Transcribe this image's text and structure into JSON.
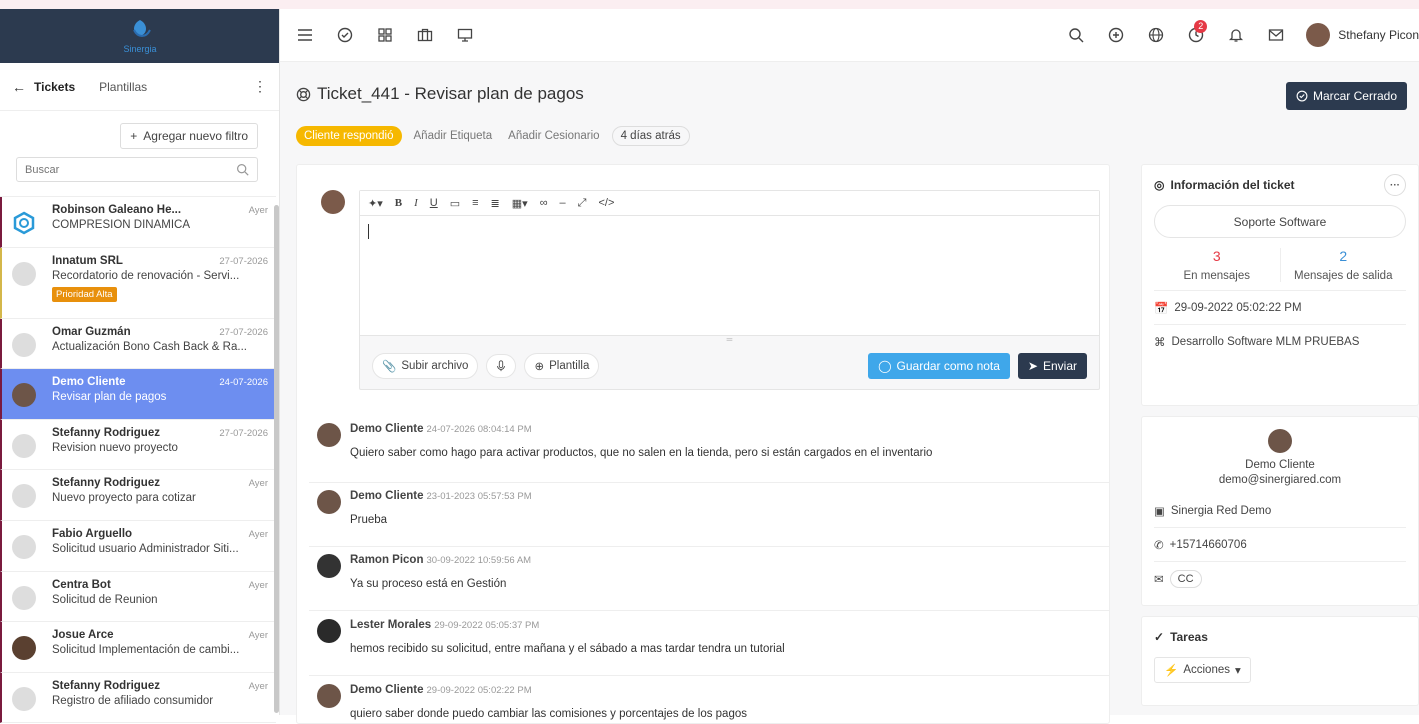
{
  "topbar": {
    "user_name": "Sthefany Picon",
    "timer_badge": "2"
  },
  "sidebar": {
    "tab_tickets": "Tickets",
    "tab_templates": "Plantillas",
    "add_filter": "Agregar nuevo filtro",
    "search_placeholder": "Buscar",
    "items": [
      {
        "name": "Robinson Galeano He...",
        "date": "Ayer",
        "subject": "COMPRESIÓN DINAMICA"
      },
      {
        "name": "Innatum SRL",
        "date": "27-07-2026",
        "subject": "Recordatorio de renovación - Servi...",
        "badge": "Prioridad Alta"
      },
      {
        "name": "Omar Guzmán",
        "date": "27-07-2026",
        "subject": "Actualización Bono Cash Back & Ra..."
      },
      {
        "name": "Demo Cliente",
        "date": "24-07-2026",
        "subject": "Revisar plan de pagos"
      },
      {
        "name": "Stefanny Rodriguez",
        "date": "27-07-2026",
        "subject": "Revision nuevo proyecto"
      },
      {
        "name": "Stefanny Rodriguez",
        "date": "Ayer",
        "subject": "Nuevo proyecto para cotizar"
      },
      {
        "name": "Fabio Arguello",
        "date": "Ayer",
        "subject": "Solicitud usuario Administrador Siti..."
      },
      {
        "name": "Centra Bot",
        "date": "Ayer",
        "subject": "Solicitud de Reunion"
      },
      {
        "name": "Josue Arce",
        "date": "Ayer",
        "subject": "Solicitud Implementación de cambi..."
      },
      {
        "name": "Stefanny Rodriguez",
        "date": "Ayer",
        "subject": "Registro de afiliado consumidor"
      }
    ]
  },
  "ticket": {
    "title": "Ticket_441 - Revisar plan de pagos",
    "close_button": "Marcar Cerrado",
    "status_tag": "Cliente respondió",
    "add_label": "Añadir Etiqueta",
    "add_assignee": "Añadir Cesionario",
    "age": "4 días atrás"
  },
  "editor": {
    "upload": "Subir archivo",
    "template": "Plantilla",
    "save_note": "Guardar como nota",
    "send": "Enviar"
  },
  "messages": [
    {
      "author": "Demo Cliente",
      "time": "24-07-2026 08:04:14 PM",
      "text": "Quiero saber como hago para activar productos, que no salen en la tienda, pero si están cargados en el inventario"
    },
    {
      "author": "Demo Cliente",
      "time": "23-01-2023 05:57:53 PM",
      "text": "Prueba"
    },
    {
      "author": "Ramon Picon",
      "time": "30-09-2022 10:59:56 AM",
      "text": "Ya su proceso está en Gestión"
    },
    {
      "author": "Lester Morales",
      "time": "29-09-2022 05:05:37 PM",
      "text": "hemos recibido su solicitud, entre mañana y el sábado a mas tardar tendra un tutorial"
    },
    {
      "author": "Demo Cliente",
      "time": "29-09-2022 05:02:22 PM",
      "text": "quiero saber donde puedo cambiar las comisiones y porcentajes de los pagos"
    }
  ],
  "info": {
    "title": "Información del ticket",
    "department": "Soporte Software",
    "in_count": "3",
    "in_label": "En mensajes",
    "out_count": "2",
    "out_label": "Mensajes de salida",
    "created": "29-09-2022 05:02:22 PM",
    "project": "Desarrollo Software MLM PRUEBAS"
  },
  "contact": {
    "name": "Demo Cliente",
    "email": "demo@sinergiared.com",
    "company": "Sinergia Red Demo",
    "phone": "+15714660706",
    "cc": "CC"
  },
  "tasks": {
    "title": "Tareas",
    "actions": "Acciones"
  }
}
